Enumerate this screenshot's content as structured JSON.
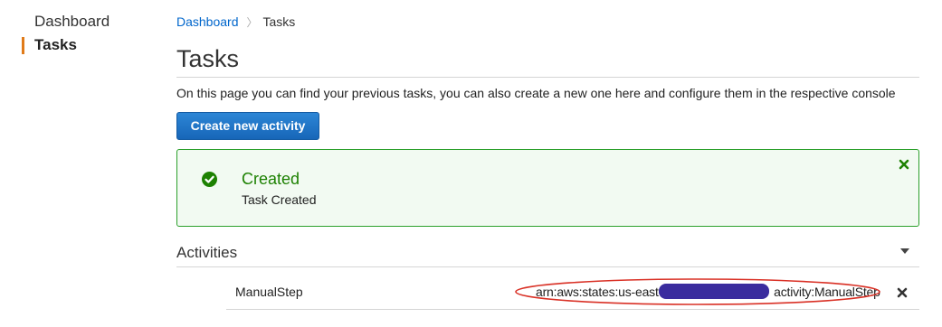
{
  "sidebar": {
    "items": [
      {
        "label": "Dashboard",
        "active": false
      },
      {
        "label": "Tasks",
        "active": true
      }
    ],
    "active_color": "#e07b1a"
  },
  "breadcrumb": {
    "link": "Dashboard",
    "current": "Tasks",
    "separator": "〉"
  },
  "page": {
    "title": "Tasks",
    "description": "On this page you can find your previous tasks, you can also create a new one here and configure them in the respective console"
  },
  "actions": {
    "create_label": "Create new activity",
    "button_color": "#1a73c8"
  },
  "alert": {
    "type": "success",
    "title": "Created",
    "message": "Task Created",
    "color": "#1d8102",
    "icon": "check-circle-icon",
    "close_icon": "close-icon"
  },
  "activities": {
    "title": "Activities",
    "collapse_icon": "caret-down-icon",
    "rows": [
      {
        "name": "ManualStep",
        "arn_prefix": "arn:aws:states:us-east-",
        "arn_suffix": "activity:ManualStep",
        "arn_redacted": true,
        "annotation_color": "#d93025",
        "delete_icon": "delete-icon"
      }
    ]
  }
}
